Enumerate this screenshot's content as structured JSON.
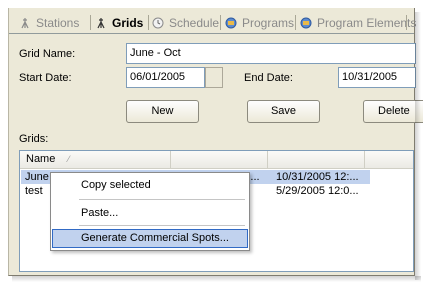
{
  "tabs": [
    {
      "label": "Stations",
      "icon": "antenna-icon",
      "active": false
    },
    {
      "label": "Grids",
      "icon": "antenna-icon",
      "active": true
    },
    {
      "label": "Schedule",
      "icon": "clock-icon",
      "active": false
    },
    {
      "label": "Programs",
      "icon": "film-icon",
      "active": false
    },
    {
      "label": "Program Elements",
      "icon": "film-icon",
      "active": false
    }
  ],
  "form": {
    "grid_name_label": "Grid Name:",
    "grid_name_value": "June - Oct",
    "start_date_label": "Start Date:",
    "start_date_value": "06/01/2005",
    "end_date_label": "End Date:",
    "end_date_value": "10/31/2005"
  },
  "buttons": {
    "new_label": "New",
    "save_label": "Save",
    "delete_label": "Delete"
  },
  "grids": {
    "label": "Grids:",
    "columns": [
      "Name",
      "",
      ""
    ],
    "rows": [
      {
        "name": "June - O",
        "col2": "6/1/2005 12:00...",
        "col3": "10/31/2005 12:...",
        "selected": true
      },
      {
        "name": "test",
        "col2": "",
        "col3": "5/29/2005 12:0...",
        "selected": false
      }
    ]
  },
  "context_menu": {
    "items": [
      {
        "label": "Copy selected",
        "highlighted": false
      },
      {
        "label": "Paste...",
        "highlighted": false
      },
      {
        "label": "Generate Commercial Spots...",
        "highlighted": true
      }
    ]
  },
  "colors": {
    "window_bg": "#ece9d8",
    "selection": "#c1d2ee",
    "field_border": "#7f9db9"
  }
}
